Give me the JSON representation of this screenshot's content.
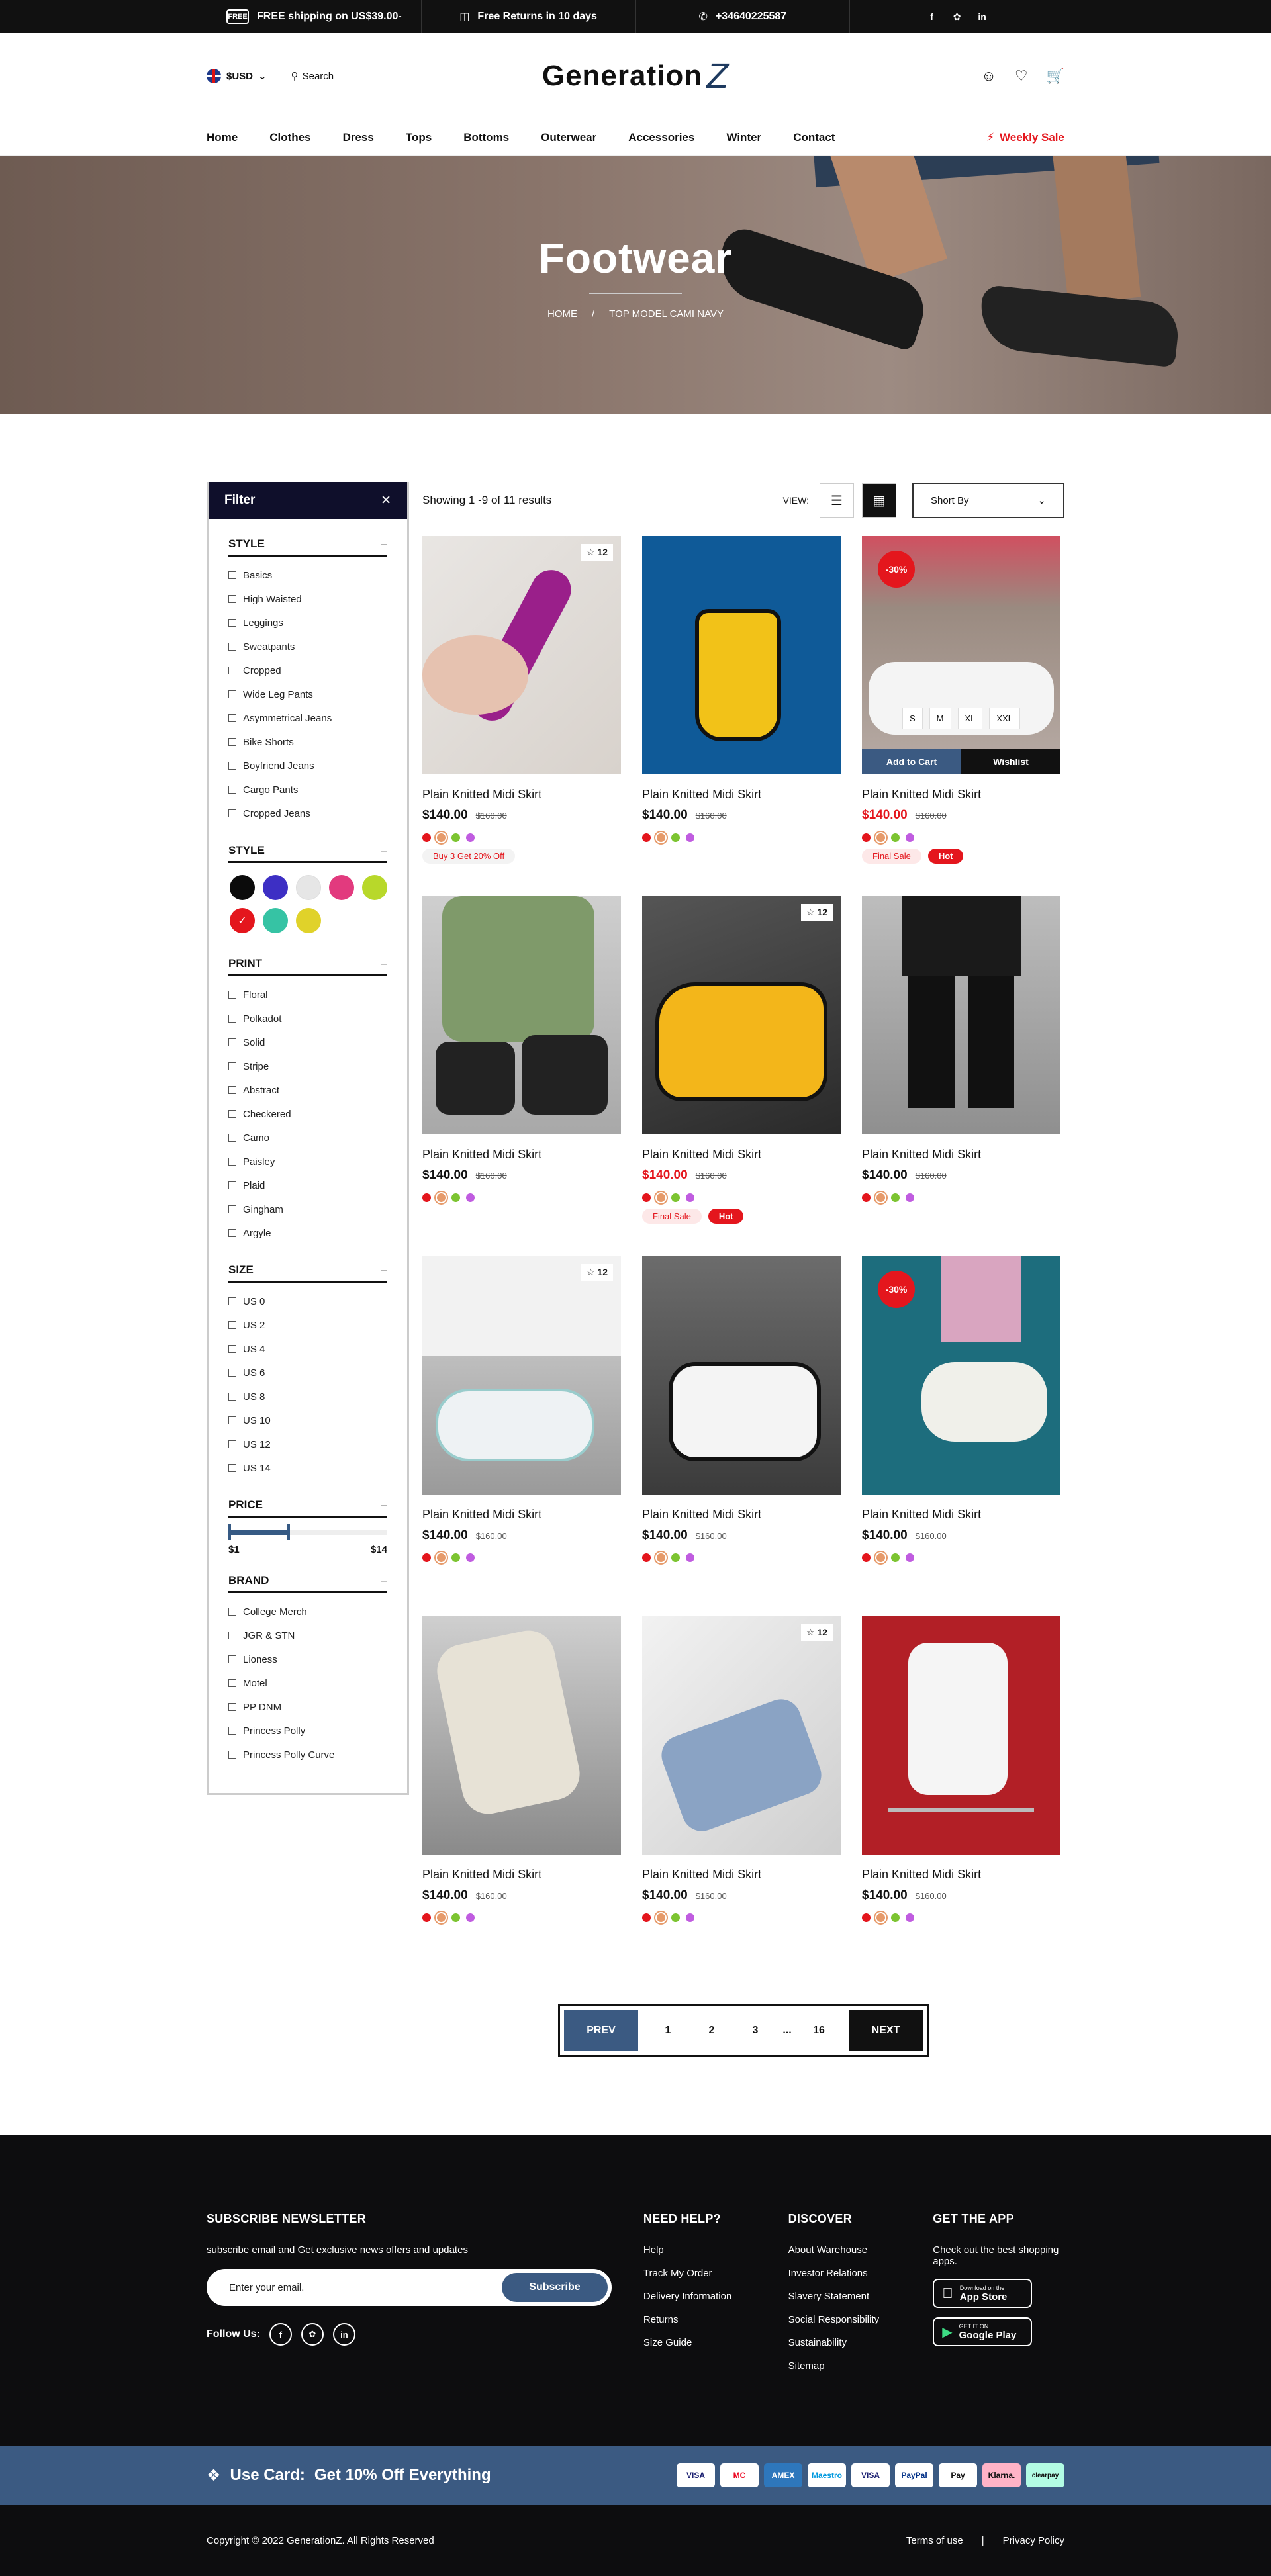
{
  "topbar": {
    "shipping_icon": "FREE",
    "shipping": "FREE shipping on US$39.00-",
    "returns": "Free Returns in 10 days",
    "phone": "+34640225587",
    "social": [
      "facebook-icon",
      "twitter-icon",
      "linkedin-icon"
    ]
  },
  "header": {
    "currency": "$USD",
    "search_label": "Search",
    "logo_text": "Generation",
    "logo_mark": "Z",
    "nav": [
      "Home",
      "Clothes",
      "Dress",
      "Tops",
      "Bottoms",
      "Outerwear",
      "Accessories",
      "Winter",
      "Contact"
    ],
    "weekly_sale": "Weekly Sale"
  },
  "hero": {
    "title": "Footwear",
    "breadcrumb": [
      "HOME",
      "/",
      "TOP MODEL CAMI NAVY"
    ]
  },
  "filter": {
    "title": "Filter",
    "style_title": "STYLE",
    "style_items": [
      "Basics",
      "High Waisted",
      "Leggings",
      "Sweatpants",
      "Cropped",
      "Wide Leg Pants",
      "Asymmetrical Jeans",
      "Bike Shorts",
      "Boyfriend Jeans",
      "Cargo Pants",
      "Cropped Jeans"
    ],
    "color_title": "STYLE",
    "colors": [
      "#0b0b0b",
      "#3d2fc4",
      "#e6e6e6",
      "#e23a7e",
      "#b8d82a",
      "#e4161d",
      "#36c3a4",
      "#e0d22a"
    ],
    "print_title": "PRINT",
    "print_items": [
      "Floral",
      "Polkadot",
      "Solid",
      "Stripe",
      "Abstract",
      "Checkered",
      "Camo",
      "Paisley",
      "Plaid",
      "Gingham",
      "Argyle"
    ],
    "size_title": "SIZE",
    "size_items": [
      "US 0",
      "US 2",
      "US 4",
      "US 6",
      "US 8",
      "US 10",
      "US 12",
      "US 14"
    ],
    "price_title": "PRICE",
    "price_min": "$1",
    "price_max": "$14",
    "brand_title": "BRAND",
    "brand_items": [
      "College Merch",
      "JGR & STN",
      "Lioness",
      "Motel",
      "PP DNM",
      "Princess Polly",
      "Princess Polly Curve"
    ],
    "collapse_symbol": "–"
  },
  "toolbar": {
    "showing": "Showing 1 -9 of 11 results",
    "view_label": "VIEW:",
    "sort": "Short By"
  },
  "card_labels": {
    "add_to_cart": "Add to Cart",
    "wishlist": "Wishlist",
    "sizes": [
      "S",
      "M",
      "XL",
      "XXL"
    ]
  },
  "products": [
    {
      "name": "Plain Knitted Midi Skirt",
      "price": "$140.00",
      "old": "$160.00",
      "star": "12",
      "off": "",
      "sale": false,
      "tags": [
        "Buy 3 Get 20% Off"
      ]
    },
    {
      "name": "Plain Knitted Midi Skirt",
      "price": "$140.00",
      "old": "$160.00",
      "star": "",
      "off": "",
      "sale": false,
      "tags": []
    },
    {
      "name": "Plain Knitted Midi Skirt",
      "price": "$140.00",
      "old": "$160.00",
      "star": "",
      "off": "-30%",
      "sale": true,
      "tags": [
        "Final Sale",
        "Hot"
      ]
    },
    {
      "name": "Plain Knitted Midi Skirt",
      "price": "$140.00",
      "old": "$160.00",
      "star": "",
      "off": "",
      "sale": false,
      "tags": []
    },
    {
      "name": "Plain Knitted Midi Skirt",
      "price": "$140.00",
      "old": "$160.00",
      "star": "12",
      "off": "",
      "sale": true,
      "tags": [
        "Final Sale",
        "Hot"
      ]
    },
    {
      "name": "Plain Knitted Midi Skirt",
      "price": "$140.00",
      "old": "$160.00",
      "star": "",
      "off": "",
      "sale": false,
      "tags": []
    },
    {
      "name": "Plain Knitted Midi Skirt",
      "price": "$140.00",
      "old": "$160.00",
      "star": "12",
      "off": "",
      "sale": false,
      "tags": []
    },
    {
      "name": "Plain Knitted Midi Skirt",
      "price": "$140.00",
      "old": "$160.00",
      "star": "",
      "off": "",
      "sale": false,
      "tags": []
    },
    {
      "name": "Plain Knitted Midi Skirt",
      "price": "$140.00",
      "old": "$160.00",
      "star": "",
      "off": "-30%",
      "sale": false,
      "tags": []
    },
    {
      "name": "Plain Knitted Midi Skirt",
      "price": "$140.00",
      "old": "$160.00",
      "star": "",
      "off": "",
      "sale": false,
      "tags": []
    },
    {
      "name": "Plain Knitted Midi Skirt",
      "price": "$140.00",
      "old": "$160.00",
      "star": "12",
      "off": "",
      "sale": false,
      "tags": []
    },
    {
      "name": "Plain Knitted Midi Skirt",
      "price": "$140.00",
      "old": "$160.00",
      "star": "",
      "off": "",
      "sale": false,
      "tags": []
    }
  ],
  "product_dot_colors": [
    "#e4161d",
    "#e69a6a",
    "#7cc431",
    "#c05ce0"
  ],
  "pagination": {
    "prev": "PREV",
    "pages": [
      "1",
      "2",
      "3",
      "...",
      "16"
    ],
    "next": "NEXT"
  },
  "footer": {
    "newsletter_title": "SUBSCRIBE NEWSLETTER",
    "newsletter_text": "subscribe email and Get exclusive news offers and updates",
    "email_placeholder": "Enter your email.",
    "subscribe": "Subscribe",
    "follow": "Follow Us:",
    "help_title": "NEED HELP?",
    "help_links": [
      "Help",
      "Track My Order",
      "Delivery Information",
      "Returns",
      "Size Guide"
    ],
    "discover_title": "DISCOVER",
    "discover_links": [
      "About Warehouse",
      "Investor Relations",
      "Slavery Statement",
      "Social Responsibility",
      "Sustainability",
      "Sitemap"
    ],
    "app_title": "GET THE APP",
    "app_text": "Check out the best shopping apps.",
    "appstore_small": "Download on the",
    "appstore_big": "App Store",
    "gplay_small": "GET IT ON",
    "gplay_big": "Google Play"
  },
  "usecard": {
    "label": "Use Card:",
    "offer": "Get 10% Off Everything",
    "cards": [
      "VISA",
      "MC",
      "AMEX",
      "Maestro",
      "VISA",
      "PayPal",
      "Pay",
      "Klarna.",
      "clearpay"
    ]
  },
  "bottom": {
    "copyright": "Copyright © 2022 GenerationZ. All Rights Reserved",
    "terms": "Terms of use",
    "sep": "|",
    "privacy": "Privacy Policy"
  }
}
